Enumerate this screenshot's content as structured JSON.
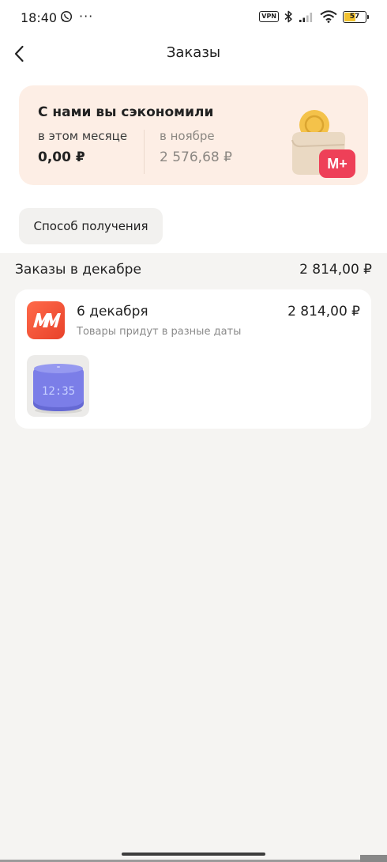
{
  "status_bar": {
    "time": "18:40",
    "more_indicator": "···",
    "vpn_label": "VPN",
    "battery_level": "57",
    "battery_fraction": 0.57,
    "icons": [
      "whatsapp-icon",
      "bluetooth-icon",
      "signal-icon",
      "wifi-icon",
      "battery-icon"
    ]
  },
  "header": {
    "title": "Заказы",
    "back_icon": "chevron-left-icon"
  },
  "savings": {
    "title": "С нами вы сэкономили",
    "current": {
      "label": "в этом месяце",
      "value": "0,00 ₽"
    },
    "previous": {
      "label": "в ноябре",
      "value": "2 576,68 ₽"
    },
    "badge_text": "M+",
    "illustration": "wallet-with-coin"
  },
  "filter": {
    "delivery_method_label": "Способ получения"
  },
  "orders_section": {
    "title": "Заказы в декабре",
    "total": "2 814,00 ₽",
    "orders": [
      {
        "date": "6 декабря",
        "amount": "2 814,00 ₽",
        "note": "Товары придут в разные даты",
        "store_logo_text": "MM",
        "product": {
          "display_time": "12:35",
          "type": "smart-speaker-clock"
        }
      }
    ]
  },
  "colors": {
    "accent": "#e8422a",
    "savings_bg": "#fdeee5",
    "page_bg": "#f5f4f2",
    "speaker": "#7b7ee8"
  }
}
